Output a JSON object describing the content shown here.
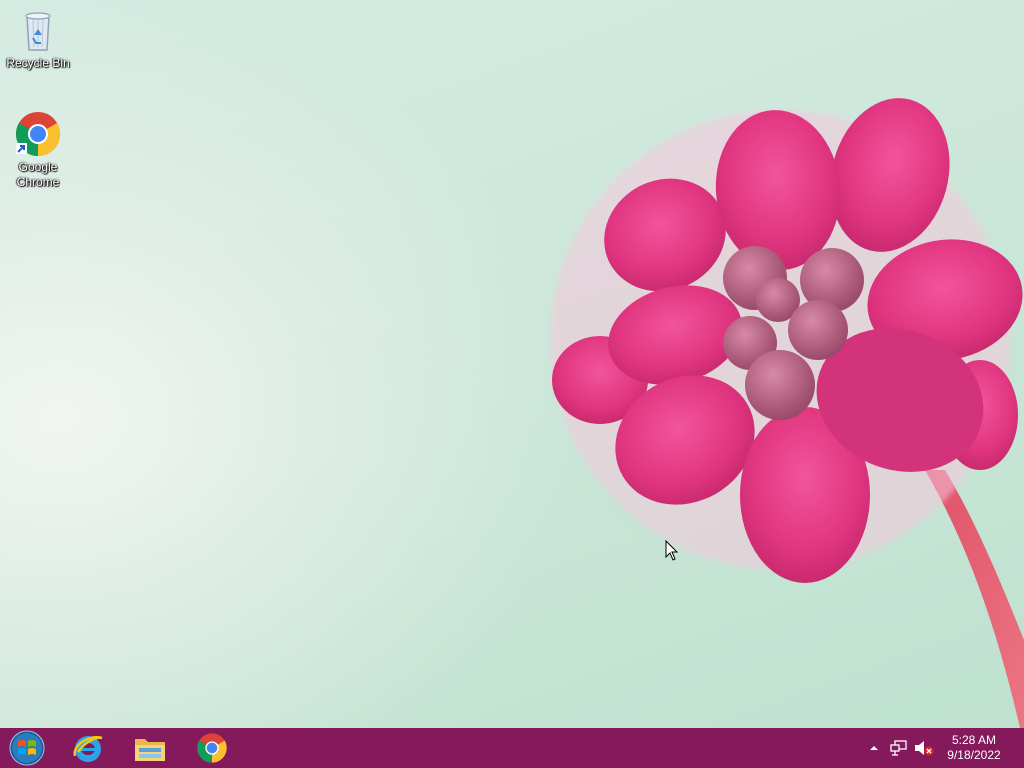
{
  "desktop": {
    "icons": [
      {
        "label": "Recycle Bin",
        "icon": "recycle-bin-icon"
      },
      {
        "label": "Google\nChrome",
        "icon": "chrome-icon"
      }
    ]
  },
  "taskbar": {
    "pinned": [
      {
        "icon": "start-orb-icon"
      },
      {
        "icon": "internet-explorer-icon"
      },
      {
        "icon": "file-explorer-icon"
      },
      {
        "icon": "chrome-icon"
      }
    ],
    "tray": {
      "icons": [
        "show-hidden-icons-arrow",
        "network-icon",
        "volume-muted-icon"
      ],
      "clock": {
        "time": "5:28 AM",
        "date": "9/18/2022"
      }
    }
  },
  "theme": {
    "taskbar_color": "#841a5c",
    "flower_color": "#e33c8a",
    "wallpaper_color": "#cfe8dc"
  }
}
